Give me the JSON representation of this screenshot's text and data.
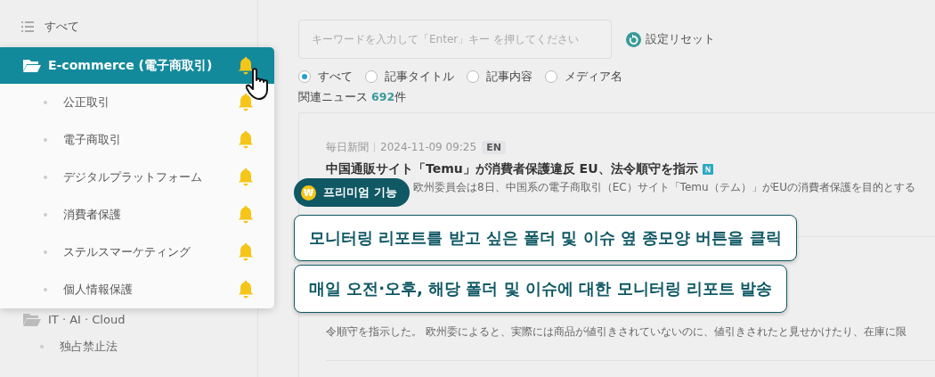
{
  "sidebar": {
    "all_label": "すべて",
    "folders": [
      {
        "label": "E-commerce (電子商取引)",
        "selected": true,
        "bell": true,
        "children": [
          {
            "label": "公正取引",
            "bell": true
          },
          {
            "label": "電子商取引",
            "bell": true
          },
          {
            "label": "デジタルプラットフォーム",
            "bell": true
          },
          {
            "label": "消費者保護",
            "bell": true
          },
          {
            "label": "ステルスマーケティング",
            "bell": true
          },
          {
            "label": "個人情報保護",
            "bell": true
          }
        ]
      },
      {
        "label": "IT · AI · Cloud",
        "selected": false,
        "bell": false,
        "children": [
          {
            "label": "独占禁止法",
            "bell": false
          }
        ]
      }
    ]
  },
  "search": {
    "placeholder": "キーワードを入力して「Enter」キー を押してください"
  },
  "reset_label": "設定リセット",
  "scope_options": [
    {
      "label": "すべて",
      "selected": true
    },
    {
      "label": "記事タイトル",
      "selected": false
    },
    {
      "label": "記事内容",
      "selected": false
    },
    {
      "label": "メディア名",
      "selected": false
    }
  ],
  "result_count": {
    "label": "関連ニュース",
    "count": "692",
    "unit": "件"
  },
  "articles": [
    {
      "source": "毎日新聞",
      "date": "2024-11-09 09:25",
      "lang": "EN",
      "title": "中国通販サイト「Temu」が消費者保護違反 EU、法令順守を指示",
      "body": [
        "欧州委員会は8日、中国系の電子商取引（EC）サイト「Temu（テム）」がEUの消費者保護を目的とする"
      ]
    },
    {
      "body": [
        "令順守を指示した。 欧州委によると、実際には商品が値引きされていないのに、値引きされたと見せかけたり、在庫に限"
      ]
    }
  ],
  "tour": {
    "badge_icon": "₩",
    "badge": "프리미엄 기능",
    "steps": [
      "모니터링 리포트를 받고 싶은 폴더 및 이슈 옆 종모양 버튼을 클릭",
      "매일 오전·오후, 해당 폴더 및 이슈에 대한 모니터링 리포트 발송"
    ]
  }
}
